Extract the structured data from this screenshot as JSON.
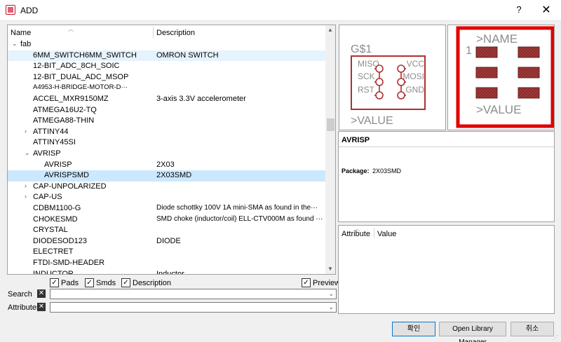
{
  "window": {
    "title": "ADD",
    "help": "?",
    "close": "✕"
  },
  "tree": {
    "col_name": "Name",
    "col_desc": "Description",
    "rows": [
      {
        "exp": "⌄",
        "name": "fab",
        "desc": ""
      },
      {
        "exp": "",
        "name": "6MM_SWITCH6MM_SWITCH",
        "desc": "OMRON SWITCH"
      },
      {
        "exp": "",
        "name": "12-BIT_ADC_8CH_SOIC",
        "desc": ""
      },
      {
        "exp": "",
        "name": "12-BIT_DUAL_ADC_MSOP",
        "desc": ""
      },
      {
        "exp": "",
        "name": "A4953-H-BRIDGE-MOTOR-D···",
        "desc": ""
      },
      {
        "exp": "",
        "name": "ACCEL_MXR9150MZ",
        "desc": "3-axis 3.3V accelerometer"
      },
      {
        "exp": "",
        "name": "ATMEGA16U2-TQ",
        "desc": ""
      },
      {
        "exp": "",
        "name": "ATMEGA88-THIN",
        "desc": ""
      },
      {
        "exp": "›",
        "name": "ATTINY44",
        "desc": ""
      },
      {
        "exp": "",
        "name": "ATTINY45SI",
        "desc": ""
      },
      {
        "exp": "⌄",
        "name": "AVRISP",
        "desc": ""
      },
      {
        "exp": "",
        "name": "AVRISP",
        "desc": "2X03"
      },
      {
        "exp": "",
        "name": "AVRISPSMD",
        "desc": "2X03SMD"
      },
      {
        "exp": "›",
        "name": "CAP-UNPOLARIZED",
        "desc": ""
      },
      {
        "exp": "›",
        "name": "CAP-US",
        "desc": ""
      },
      {
        "exp": "",
        "name": "CDBM1100-G",
        "desc": "Diode schottky 100V 1A mini-SMA as found in the···"
      },
      {
        "exp": "",
        "name": "CHOKESMD",
        "desc": "SMD choke (inductor/coil) ELL-CTV000M as found ···"
      },
      {
        "exp": "",
        "name": "CRYSTAL",
        "desc": ""
      },
      {
        "exp": "",
        "name": "DIODESOD123",
        "desc": "DIODE"
      },
      {
        "exp": "",
        "name": "ELECTRET",
        "desc": ""
      },
      {
        "exp": "",
        "name": "FTDI-SMD-HEADER",
        "desc": ""
      },
      {
        "exp": "",
        "name": "INDUCTOR",
        "desc": "Inductor"
      }
    ]
  },
  "options": {
    "pads": "Pads",
    "smds": "Smds",
    "description": "Description",
    "preview": "Preview",
    "checkmark": "✓"
  },
  "search": {
    "label": "Search",
    "value": ""
  },
  "attributes_filter": {
    "label": "Attributes",
    "value": ""
  },
  "symbol": {
    "name": "G$1",
    "value": ">VALUE",
    "pins_left": [
      "MISO",
      "SCK",
      "RST"
    ],
    "pins_right": [
      "VCC",
      "MOSI",
      "GND"
    ]
  },
  "package": {
    "name": ">NAME",
    "value": ">VALUE",
    "pin1": "1"
  },
  "info": {
    "title": "AVRISP",
    "package_label": "Package:",
    "package_value": "2X03SMD"
  },
  "attr_table": {
    "col_attribute": "Attribute",
    "col_value": "Value"
  },
  "buttons": {
    "ok": "확인",
    "library_manager": "Open Library Manager",
    "cancel": "취소"
  },
  "colors": {
    "symbol_red": "#b03030",
    "symbol_gray": "#8c8c8c",
    "highlight_red": "#e00000",
    "pad_fill": "#8c2a2a",
    "selection": "#cce8ff"
  }
}
